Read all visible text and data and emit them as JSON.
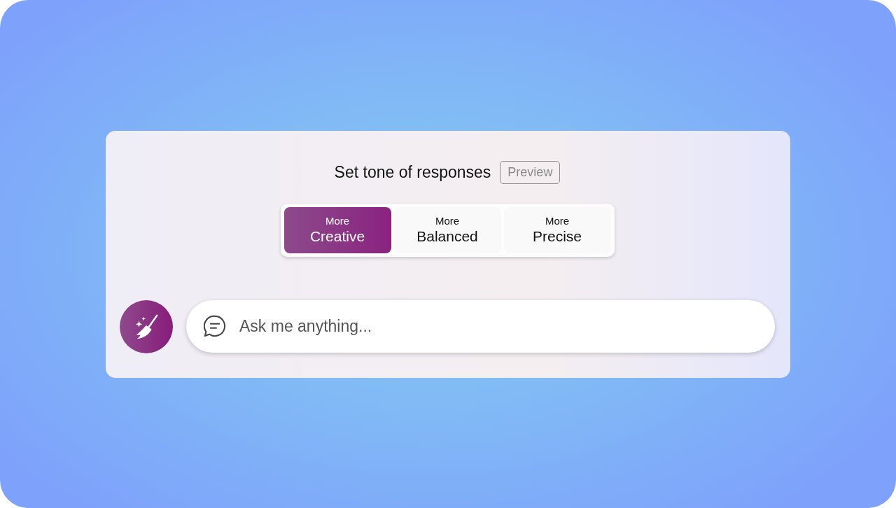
{
  "heading": {
    "title": "Set tone of responses",
    "badge": "Preview"
  },
  "tones": [
    {
      "prefix": "More",
      "label": "Creative",
      "selected": true
    },
    {
      "prefix": "More",
      "label": "Balanced",
      "selected": false
    },
    {
      "prefix": "More",
      "label": "Precise",
      "selected": false
    }
  ],
  "chat": {
    "placeholder": "Ask me anything..."
  }
}
